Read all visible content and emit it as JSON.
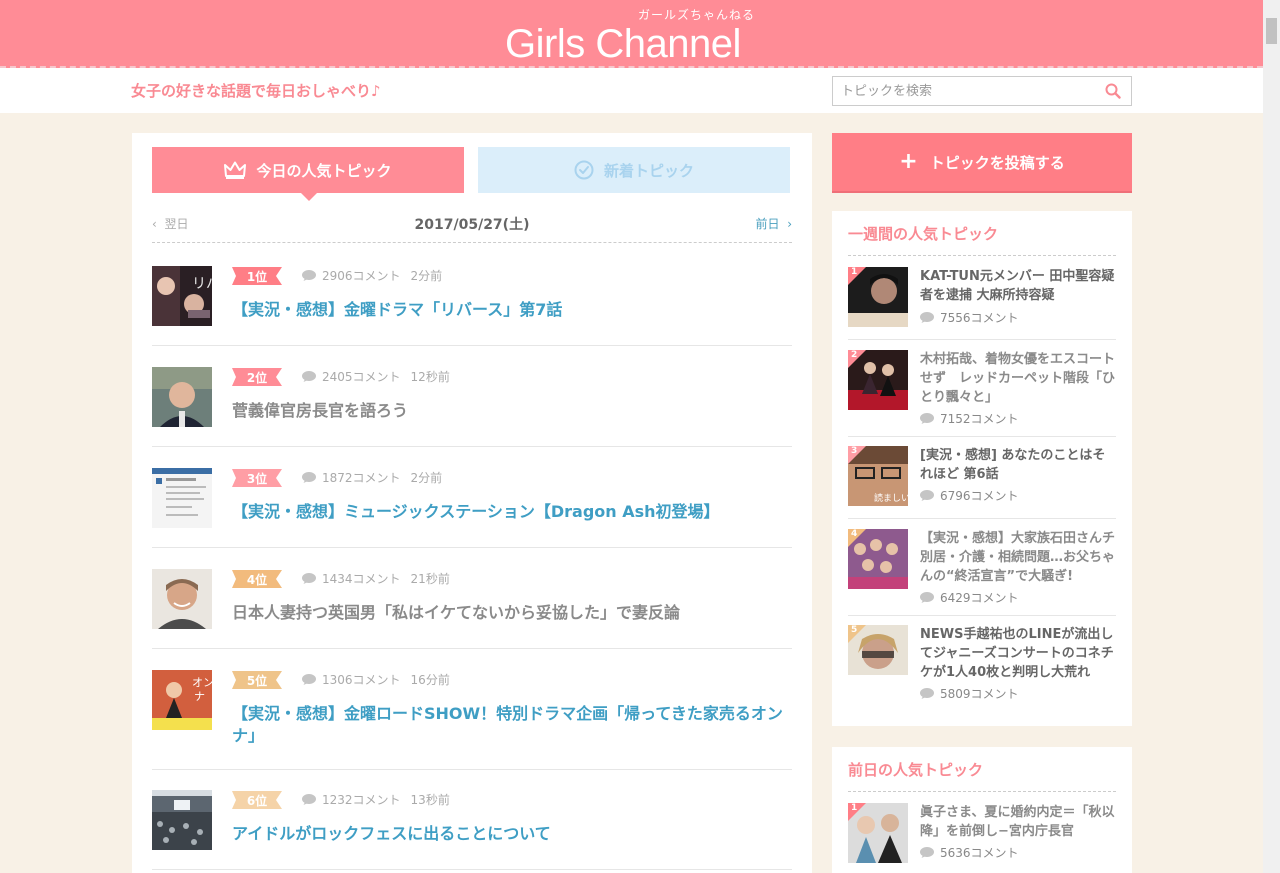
{
  "header": {
    "logo": "Girls Channel",
    "logo_sub": "ガールズちゃんねる",
    "tagline": "女子の好きな話題で毎日おしゃべり♪",
    "search_placeholder": "トピックを検索"
  },
  "tabs": {
    "popular": "今日の人気トピック",
    "new": "新着トピック"
  },
  "datenav": {
    "prev": "翌日",
    "date": "2017/05/27(土)",
    "next": "前日"
  },
  "colors": {
    "brand": "#ff8c96",
    "link": "#3f9ec4",
    "rank1": "#ff7e86",
    "rank2": "#ff8c96",
    "rank3": "#ff9ea5",
    "rank4": "#f2bb7d",
    "rank5": "#efc48a",
    "rank6": "#f5d3a8"
  },
  "topics": [
    {
      "rank": "1位",
      "comments": "2906コメント",
      "time": "2分前",
      "title": "【実況・感想】金曜ドラマ「リバース」第7話"
    },
    {
      "rank": "2位",
      "comments": "2405コメント",
      "time": "12秒前",
      "title": "菅義偉官房長官を語ろう"
    },
    {
      "rank": "3位",
      "comments": "1872コメント",
      "time": "2分前",
      "title": "【実況・感想】ミュージックステーション【Dragon Ash初登場】"
    },
    {
      "rank": "4位",
      "comments": "1434コメント",
      "time": "21秒前",
      "title": "日本人妻持つ英国男「私はイケてないから妥協した」で妻反論"
    },
    {
      "rank": "5位",
      "comments": "1306コメント",
      "time": "16分前",
      "title": "【実況・感想】金曜ロードSHOW！特別ドラマ企画「帰ってきた家売るオンナ」"
    },
    {
      "rank": "6位",
      "comments": "1232コメント",
      "time": "13秒前",
      "title": "アイドルがロックフェスに出ることについて"
    }
  ],
  "sidebar": {
    "post_button": "トピックを投稿する",
    "weekly_heading": "一週間の人気トピック",
    "weekly": [
      {
        "num": "1",
        "title": "KAT-TUN元メンバー 田中聖容疑者を逮捕 大麻所持容疑",
        "comments": "7556コメント"
      },
      {
        "num": "2",
        "title": "木村拓哉、着物女優をエスコートせず　レッドカーペット階段「ひとり飄々と」",
        "comments": "7152コメント"
      },
      {
        "num": "3",
        "title": "[実況・感想] あなたのことはそれほど 第6話",
        "comments": "6796コメント"
      },
      {
        "num": "4",
        "title": "【実況・感想】大家族石田さんチ　別居・介護・相続問題…お父ちゃんの“終活宣言”で大騒ぎ!",
        "comments": "6429コメント"
      },
      {
        "num": "5",
        "title": "NEWS手越祐也のLINEが流出してジャニーズコンサートのコネチケが1人40枚と判明し大荒れ",
        "comments": "5809コメント"
      }
    ],
    "prev_heading": "前日の人気トピック",
    "prev": [
      {
        "num": "1",
        "title": "眞子さま、夏に婚約内定＝「秋以降」を前倒し−宮内庁長官",
        "comments": "5636コメント"
      }
    ]
  }
}
